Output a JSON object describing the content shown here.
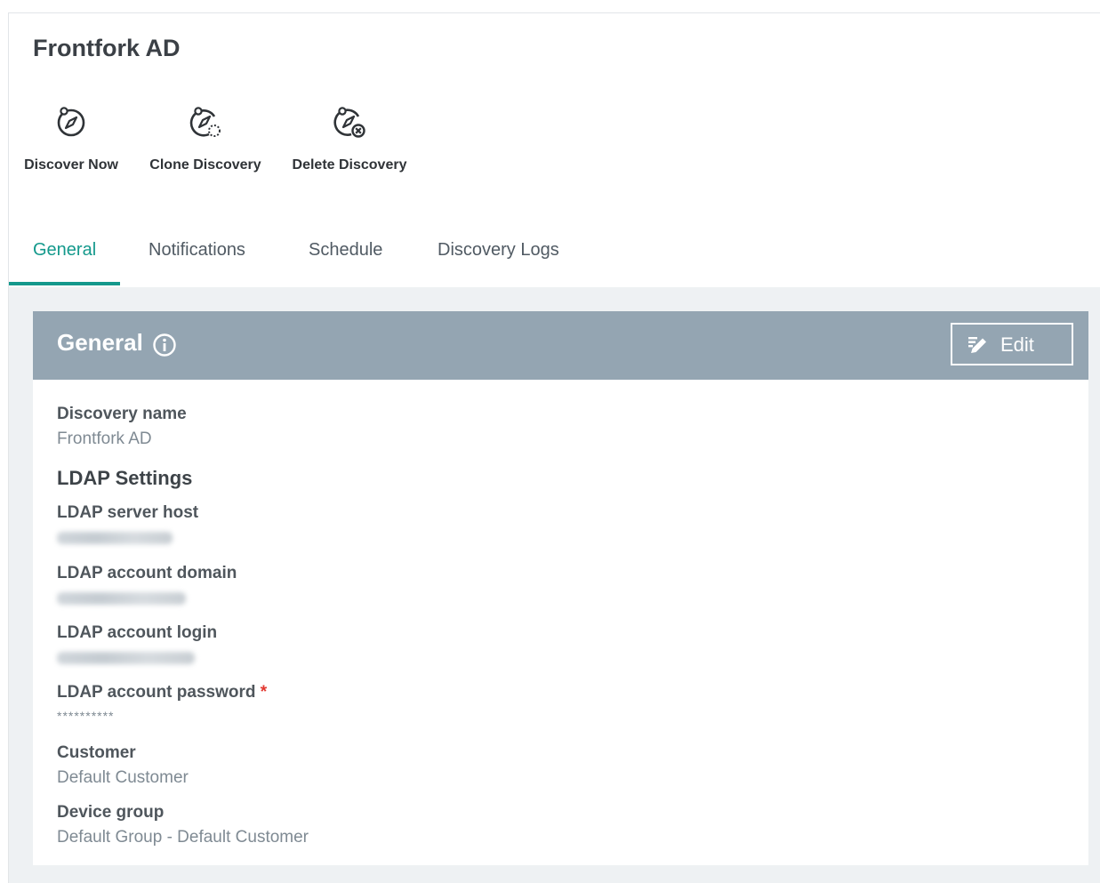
{
  "page": {
    "title": "Frontfork AD"
  },
  "toolbar": {
    "discover_now": {
      "label": "Discover Now",
      "icon": "compass-icon"
    },
    "clone_discovery": {
      "label": "Clone Discovery",
      "icon": "compass-clone-icon"
    },
    "delete_discovery": {
      "label": "Delete Discovery",
      "icon": "compass-delete-icon"
    }
  },
  "tabs": [
    {
      "label": "General",
      "active": true
    },
    {
      "label": "Notifications",
      "active": false
    },
    {
      "label": "Schedule",
      "active": false
    },
    {
      "label": "Discovery Logs",
      "active": false
    }
  ],
  "panel": {
    "title": "General",
    "edit_label": "Edit"
  },
  "fields": {
    "discovery_name_label": "Discovery name",
    "discovery_name_value": "Frontfork AD",
    "ldap_settings_heading": "LDAP Settings",
    "ldap_server_host_label": "LDAP server host",
    "ldap_account_domain_label": "LDAP account domain",
    "ldap_account_login_label": "LDAP account login",
    "ldap_account_password_label": "LDAP account password",
    "required_mark": "*",
    "ldap_account_password_value": "**********",
    "customer_label": "Customer",
    "customer_value": "Default Customer",
    "device_group_label": "Device group",
    "device_group_value": "Default Group - Default Customer"
  },
  "colors": {
    "accent": "#14998c",
    "panel_header": "#94a5b2",
    "required": "#e2372f"
  }
}
